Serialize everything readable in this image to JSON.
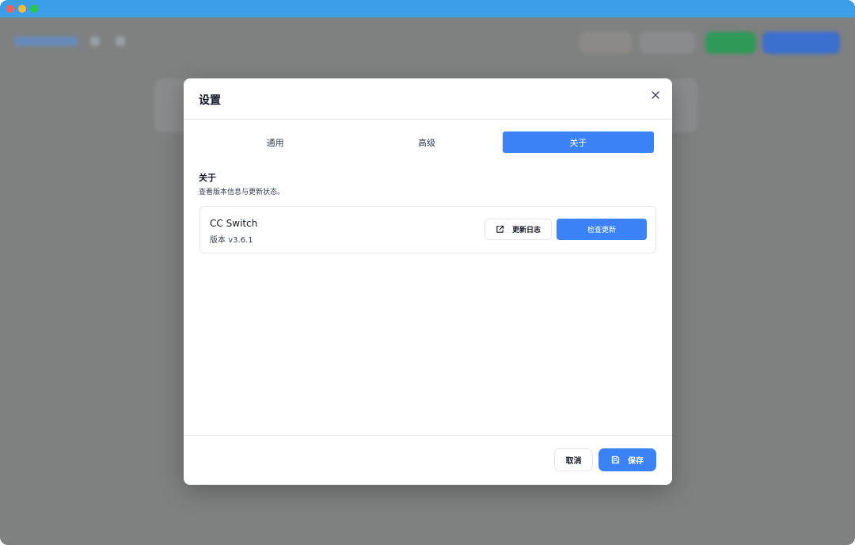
{
  "dialog": {
    "title": "设置",
    "close_icon": "close-icon"
  },
  "tabs": [
    {
      "label": "通用",
      "active": false
    },
    {
      "label": "高级",
      "active": false
    },
    {
      "label": "关于",
      "active": true
    }
  ],
  "about": {
    "section_title": "关于",
    "section_desc": "查看版本信息与更新状态。",
    "app_name": "CC Switch",
    "version_label": "版本",
    "version_value": "v3.6.1",
    "changelog_label": "更新日志",
    "changelog_icon": "external-link-icon",
    "check_update_label": "检查更新"
  },
  "footer": {
    "cancel_label": "取消",
    "save_label": "保存",
    "save_icon": "save-icon"
  },
  "colors": {
    "accent": "#3b82f6",
    "titlebar": "#3c9ee6",
    "overlay": "#7f8080"
  }
}
